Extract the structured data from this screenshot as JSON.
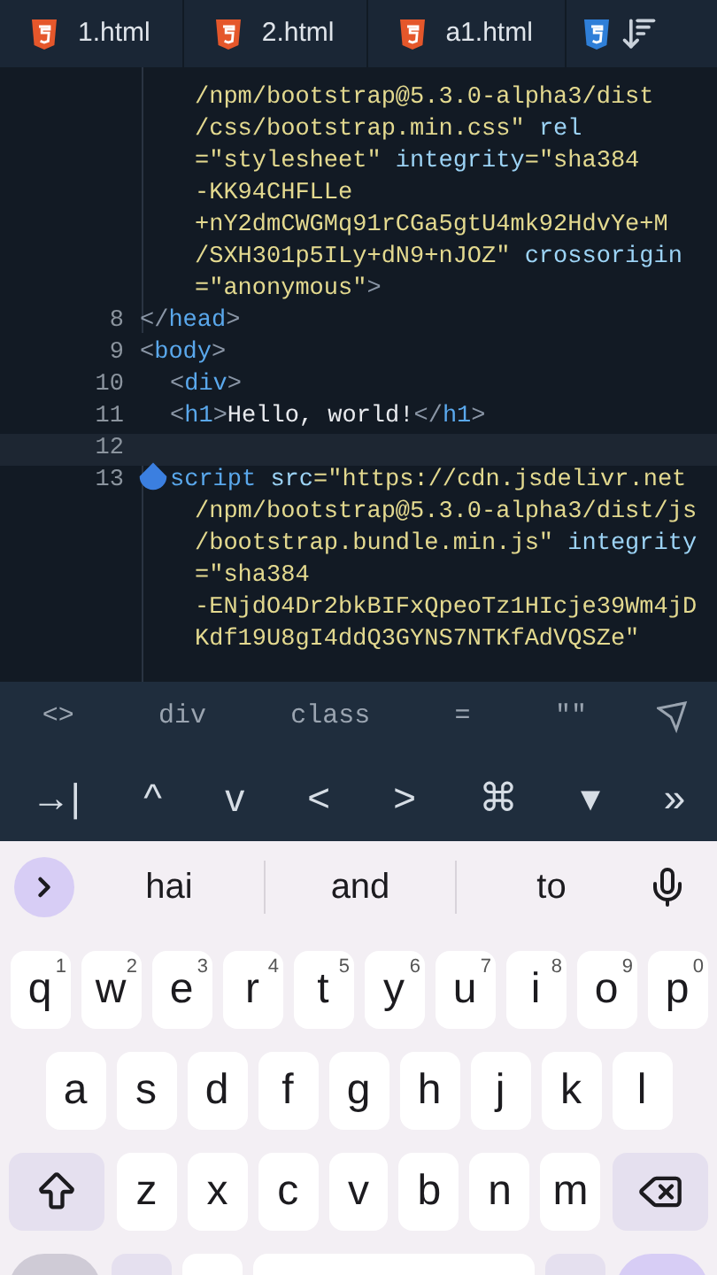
{
  "tabs": [
    {
      "label": "1.html",
      "kind": "html"
    },
    {
      "label": "2.html",
      "kind": "html"
    },
    {
      "label": "a1.html",
      "kind": "html"
    },
    {
      "kind": "css"
    }
  ],
  "code": [
    {
      "kind": "wrap",
      "segments": [
        {
          "kind": "string",
          "text": "/npm/bootstrap@5.3.0-alpha3/dist"
        }
      ]
    },
    {
      "kind": "wrap",
      "segments": [
        {
          "kind": "string",
          "text": "/css/bootstrap.min.css\""
        },
        {
          "kind": "attr",
          "text": " rel"
        }
      ]
    },
    {
      "kind": "wrap",
      "segments": [
        {
          "kind": "string",
          "text": "=\"stylesheet\""
        },
        {
          "kind": "attr",
          "text": " integrity"
        },
        {
          "kind": "string",
          "text": "=\"sha384"
        }
      ]
    },
    {
      "kind": "wrap",
      "segments": [
        {
          "kind": "string",
          "text": "-KK94CHFLLe"
        }
      ]
    },
    {
      "kind": "wrap",
      "segments": [
        {
          "kind": "string",
          "text": "+nY2dmCWGMq91rCGa5gtU4mk92HdvYe+M"
        }
      ]
    },
    {
      "kind": "wrap",
      "segments": [
        {
          "kind": "string",
          "text": "/SXH301p5ILy+dN9+nJOZ\""
        },
        {
          "kind": "attr",
          "text": " crossorigin"
        }
      ]
    },
    {
      "kind": "wrap",
      "segments": [
        {
          "kind": "string",
          "text": "=\"anonymous\""
        },
        {
          "kind": "punct",
          "text": ">"
        }
      ]
    },
    {
      "kind": "line",
      "number": "8",
      "segments": [
        {
          "kind": "punct",
          "text": "</"
        },
        {
          "kind": "tag",
          "text": "head"
        },
        {
          "kind": "punct",
          "text": ">"
        }
      ]
    },
    {
      "kind": "line",
      "number": "9",
      "segments": [
        {
          "kind": "punct",
          "text": "<"
        },
        {
          "kind": "tag",
          "text": "body"
        },
        {
          "kind": "punct",
          "text": ">"
        }
      ]
    },
    {
      "kind": "child",
      "number": "10",
      "segments": [
        {
          "kind": "punct",
          "text": "<"
        },
        {
          "kind": "tag",
          "text": "div"
        },
        {
          "kind": "punct",
          "text": ">"
        }
      ]
    },
    {
      "kind": "child",
      "number": "11",
      "segments": [
        {
          "kind": "punct",
          "text": "<"
        },
        {
          "kind": "tag",
          "text": "h1"
        },
        {
          "kind": "punct",
          "text": ">"
        },
        {
          "kind": "text",
          "text": "Hello, world!"
        },
        {
          "kind": "punct",
          "text": "</"
        },
        {
          "kind": "tag",
          "text": "h1"
        },
        {
          "kind": "punct",
          "text": ">"
        }
      ]
    },
    {
      "kind": "current",
      "number": "12"
    },
    {
      "kind": "child",
      "number": "13",
      "cursor": true,
      "segments": [
        {
          "kind": "tag",
          "text": "script"
        },
        {
          "kind": "attr",
          "text": " src"
        },
        {
          "kind": "string",
          "text": "=\"https://cdn.jsdelivr.net"
        }
      ]
    },
    {
      "kind": "wrap",
      "segments": [
        {
          "kind": "string",
          "text": "/npm/bootstrap@5.3.0-alpha3/dist/js"
        }
      ]
    },
    {
      "kind": "wrap",
      "segments": [
        {
          "kind": "string",
          "text": "/bootstrap.bundle.min.js\""
        },
        {
          "kind": "attr",
          "text": " integrity"
        }
      ]
    },
    {
      "kind": "wrap",
      "segments": [
        {
          "kind": "string",
          "text": "=\"sha384"
        }
      ]
    },
    {
      "kind": "wrap",
      "segments": [
        {
          "kind": "string",
          "text": "-ENjdO4Dr2bkBIFxQpeoTz1HIcje39Wm4jD"
        }
      ]
    },
    {
      "kind": "wrap",
      "segments": [
        {
          "kind": "string",
          "text": "Kdf19U8gI4ddQ3GYNS7NTKfAdVQSZe\""
        }
      ]
    }
  ],
  "snippets": [
    "<>",
    "div",
    "class",
    "=",
    "\"\""
  ],
  "nav_keys": [
    "→|",
    "^",
    "v",
    "<",
    ">",
    "⌘",
    "▾",
    "»"
  ],
  "suggestions": [
    "hai",
    "and",
    "to"
  ],
  "keyboard": [
    [
      {
        "label": "q",
        "hint": "1"
      },
      {
        "label": "w",
        "hint": "2"
      },
      {
        "label": "e",
        "hint": "3"
      },
      {
        "label": "r",
        "hint": "4"
      },
      {
        "label": "t",
        "hint": "5"
      },
      {
        "label": "y",
        "hint": "6"
      },
      {
        "label": "u",
        "hint": "7"
      },
      {
        "label": "i",
        "hint": "8"
      },
      {
        "label": "o",
        "hint": "9"
      },
      {
        "label": "p",
        "hint": "0"
      }
    ],
    [
      {
        "label": "a"
      },
      {
        "label": "s"
      },
      {
        "label": "d"
      },
      {
        "label": "f"
      },
      {
        "label": "g"
      },
      {
        "label": "h"
      },
      {
        "label": "j"
      },
      {
        "label": "k"
      },
      {
        "label": "l"
      }
    ],
    [
      {
        "label": "z"
      },
      {
        "label": "x"
      },
      {
        "label": "c"
      },
      {
        "label": "v"
      },
      {
        "label": "b"
      },
      {
        "label": "n"
      },
      {
        "label": "m"
      }
    ]
  ]
}
